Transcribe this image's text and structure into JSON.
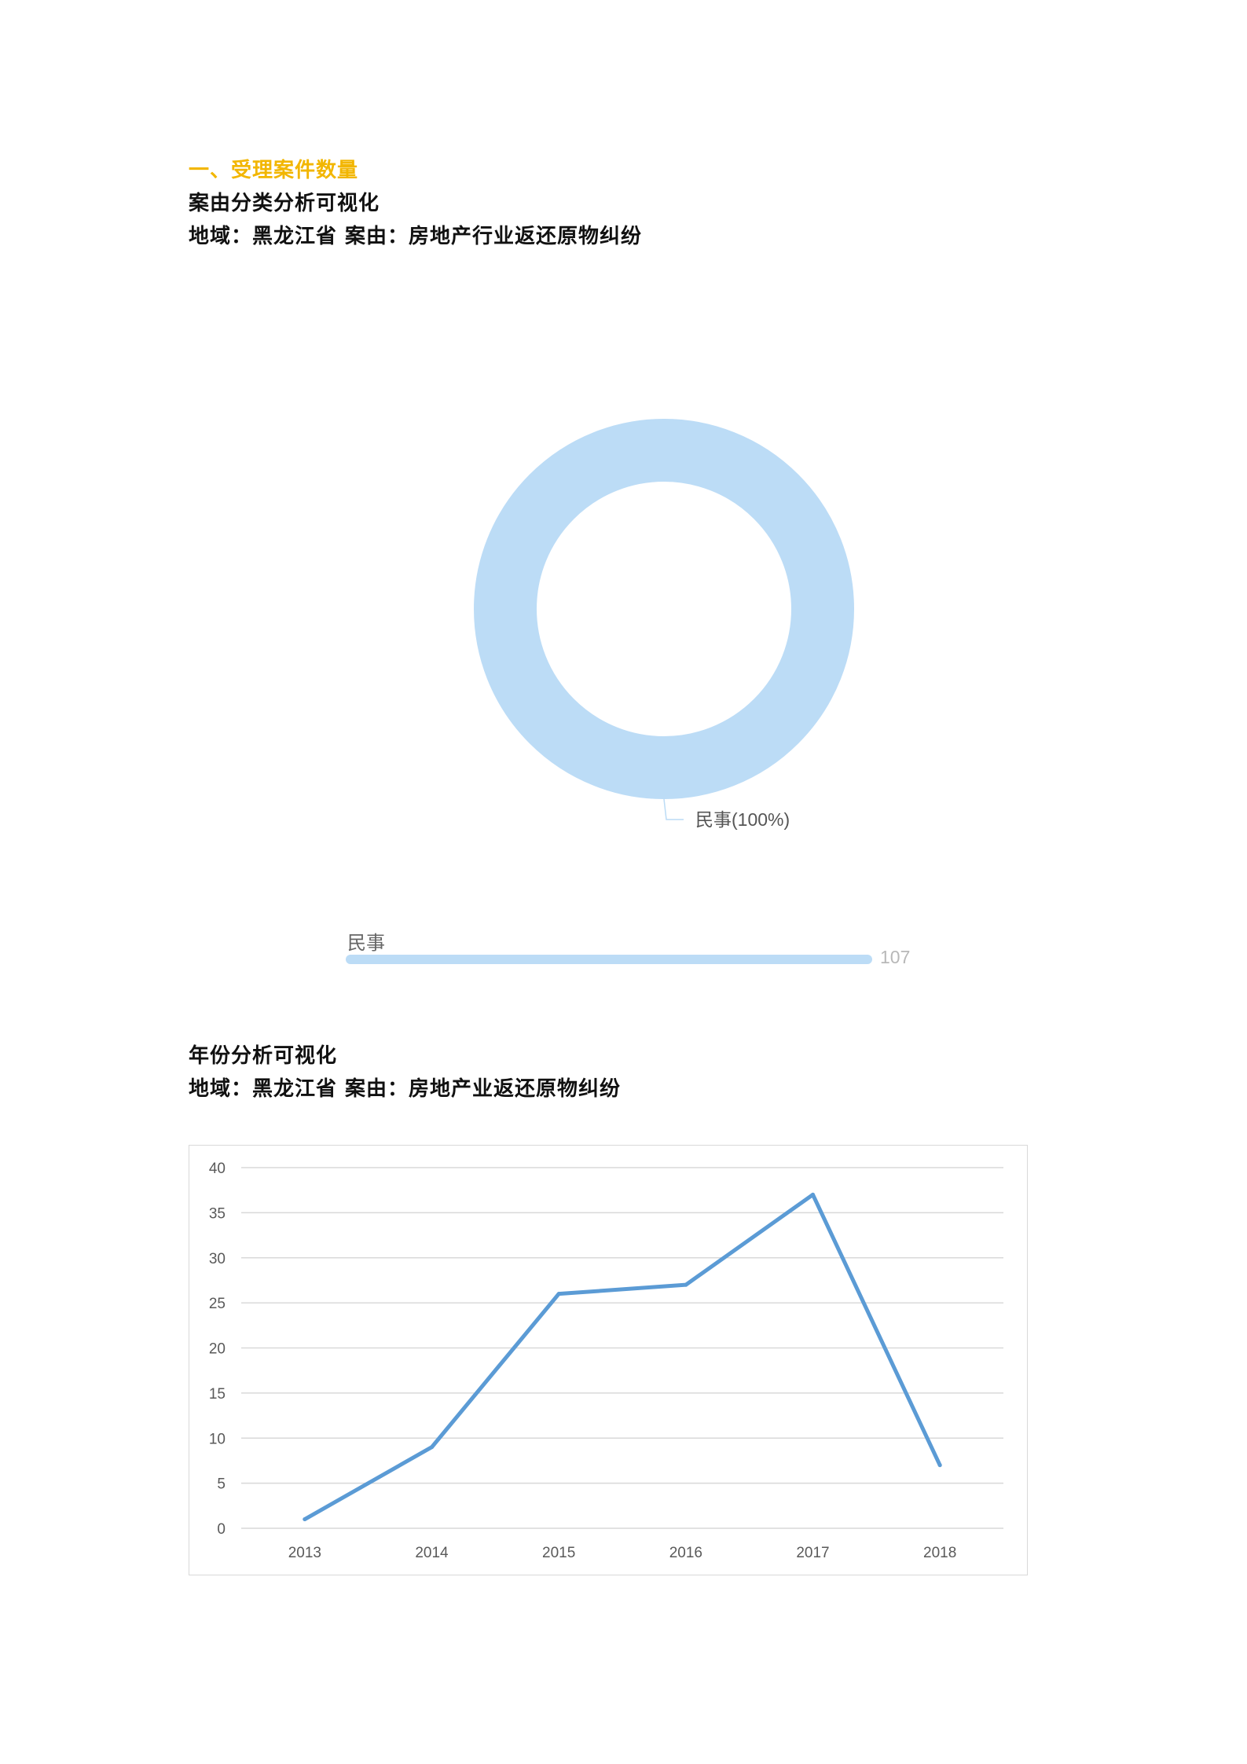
{
  "section": {
    "heading": "一、受理案件数量"
  },
  "cause_chart": {
    "title": "案由分类分析可视化",
    "filter": "地域：黑龙江省  案由：房地产行业返还原物纠纷"
  },
  "year_chart": {
    "title": "年份分析可视化",
    "filter": "地域：黑龙江省  案由：房地产业返还原物纠纷"
  },
  "chart_data": [
    {
      "type": "pie",
      "variant": "donut",
      "slices": [
        {
          "name": "民事",
          "value": 100,
          "label": "民事(100%)",
          "color": "#bcdcf6"
        }
      ],
      "label_line_color": "#bcdcf6"
    },
    {
      "type": "bar",
      "orientation": "horizontal",
      "categories": [
        "民事"
      ],
      "values": [
        107
      ],
      "value_label": "107",
      "color": "#bcdcf6"
    },
    {
      "type": "line",
      "x": [
        "2013",
        "2014",
        "2015",
        "2016",
        "2017",
        "2018"
      ],
      "series": [
        {
          "values": [
            1,
            9,
            26,
            27,
            37,
            7
          ]
        }
      ],
      "ylim": [
        0,
        40
      ],
      "yticks": [
        "0",
        "5",
        "10",
        "15",
        "20",
        "25",
        "30",
        "35",
        "40"
      ],
      "grid": true,
      "line_color": "#5b9bd5",
      "grid_color": "#d9d9d9",
      "tick_color": "#595959"
    }
  ]
}
